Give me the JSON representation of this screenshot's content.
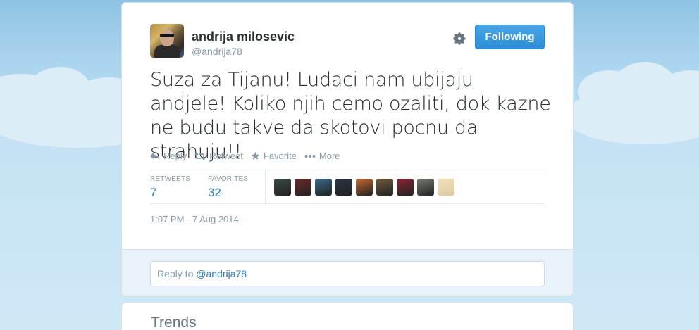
{
  "tweet": {
    "author_name": "andrija milosevic",
    "author_handle": "@andrija78",
    "follow_label": "Following",
    "text": "Suza za Tijanu! Ludaci nam ubijaju andjele! Koliko njih cemo ozaliti, dok kazne ne budu takve da skotovi pocnu da strahuju!!",
    "actions": {
      "reply": "Reply",
      "retweet": "Retweet",
      "favorite": "Favorite",
      "more": "More"
    },
    "stats": {
      "retweets_label": "RETWEETS",
      "retweets_value": "7",
      "favorites_label": "FAVORITES",
      "favorites_value": "32"
    },
    "timestamp": "1:07 PM - 7 Aug 2014"
  },
  "favoriters": [
    {
      "color": "#3a4a44"
    },
    {
      "color": "#6b2a28"
    },
    {
      "color": "#3b6a8a"
    },
    {
      "color": "#2a3446"
    },
    {
      "color": "#c5692e"
    },
    {
      "color": "#6d5a3c"
    },
    {
      "color": "#8a2633"
    },
    {
      "color": "#7a7a72"
    },
    {
      "color": "#e0caa0"
    }
  ],
  "reply": {
    "prefix": "Reply to ",
    "mention": "@andrija78"
  },
  "trends": {
    "title": "Trends"
  },
  "colors": {
    "accent": "#2b7bb9",
    "button": "#2b8fd6",
    "background": "#a9d3ee"
  }
}
